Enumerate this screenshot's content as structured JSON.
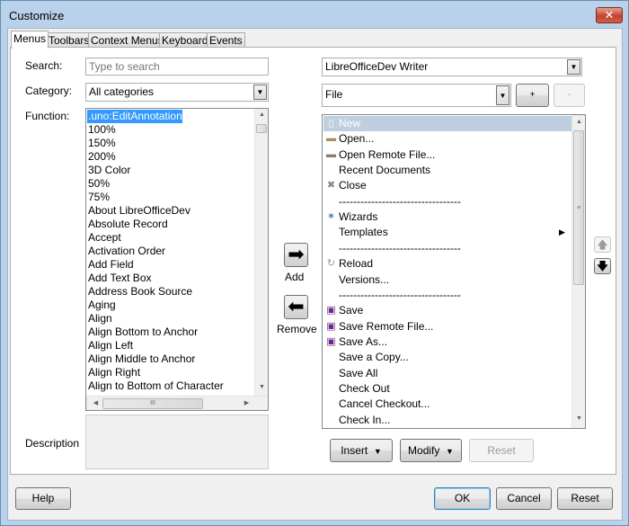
{
  "window": {
    "title": "Customize",
    "close_glyph": "✕"
  },
  "tabs": [
    "Menus",
    "Toolbars",
    "Context Menus",
    "Keyboard",
    "Events"
  ],
  "left": {
    "search_label": "Search:",
    "search_placeholder": "Type to search",
    "category_label": "Category:",
    "category_value": "All categories",
    "function_label": "Function:",
    "functions": [
      ".uno:EditAnnotation",
      "100%",
      "150%",
      "200%",
      "3D Color",
      "50%",
      "75%",
      "About LibreOfficeDev",
      "Absolute Record",
      "Accept",
      "Activation Order",
      "Add Field",
      "Add Text Box",
      "Address Book Source",
      "Aging",
      "Align",
      "Align Bottom to Anchor",
      "Align Left",
      "Align Middle to Anchor",
      "Align Right",
      "Align to Bottom of Character"
    ],
    "hscroll_grip": "III",
    "description_label": "Description"
  },
  "middle": {
    "add_label": "Add",
    "remove_label": "Remove"
  },
  "right": {
    "scope_value": "LibreOfficeDev Writer",
    "menu_value": "File",
    "plus_label": "+",
    "minus_label": "-",
    "entries": [
      {
        "label": "New",
        "icon": "new-document-icon",
        "glyph": "▯"
      },
      {
        "label": "Open...",
        "icon": "folder-icon",
        "glyph": "▬"
      },
      {
        "label": "Open Remote File...",
        "icon": "remote-folder-icon",
        "glyph": "▬"
      },
      {
        "label": "Recent Documents",
        "icon": "",
        "glyph": ""
      },
      {
        "label": "Close",
        "icon": "close-icon",
        "glyph": "✖"
      },
      {
        "label": "----------------------------------",
        "icon": "",
        "glyph": ""
      },
      {
        "label": "Wizards",
        "icon": "wizard-icon",
        "glyph": "✶"
      },
      {
        "label": "Templates",
        "icon": "",
        "glyph": "",
        "submenu": "▶"
      },
      {
        "label": "----------------------------------",
        "icon": "",
        "glyph": ""
      },
      {
        "label": "Reload",
        "icon": "reload-icon",
        "glyph": "↻"
      },
      {
        "label": "Versions...",
        "icon": "",
        "glyph": ""
      },
      {
        "label": "----------------------------------",
        "icon": "",
        "glyph": ""
      },
      {
        "label": "Save",
        "icon": "save-icon",
        "glyph": "▣"
      },
      {
        "label": "Save Remote File...",
        "icon": "save-remote-icon",
        "glyph": "▣"
      },
      {
        "label": "Save As...",
        "icon": "save-as-icon",
        "glyph": "▣"
      },
      {
        "label": "Save a Copy...",
        "icon": "",
        "glyph": ""
      },
      {
        "label": "Save All",
        "icon": "",
        "glyph": ""
      },
      {
        "label": "Check Out",
        "icon": "",
        "glyph": ""
      },
      {
        "label": "Cancel Checkout...",
        "icon": "",
        "glyph": ""
      },
      {
        "label": "Check In...",
        "icon": "",
        "glyph": ""
      }
    ],
    "insert_label": "Insert",
    "modify_label": "Modify",
    "reset_label": "Reset"
  },
  "footer": {
    "help_label": "Help",
    "ok_label": "OK",
    "cancel_label": "Cancel",
    "reset_label": "Reset"
  }
}
